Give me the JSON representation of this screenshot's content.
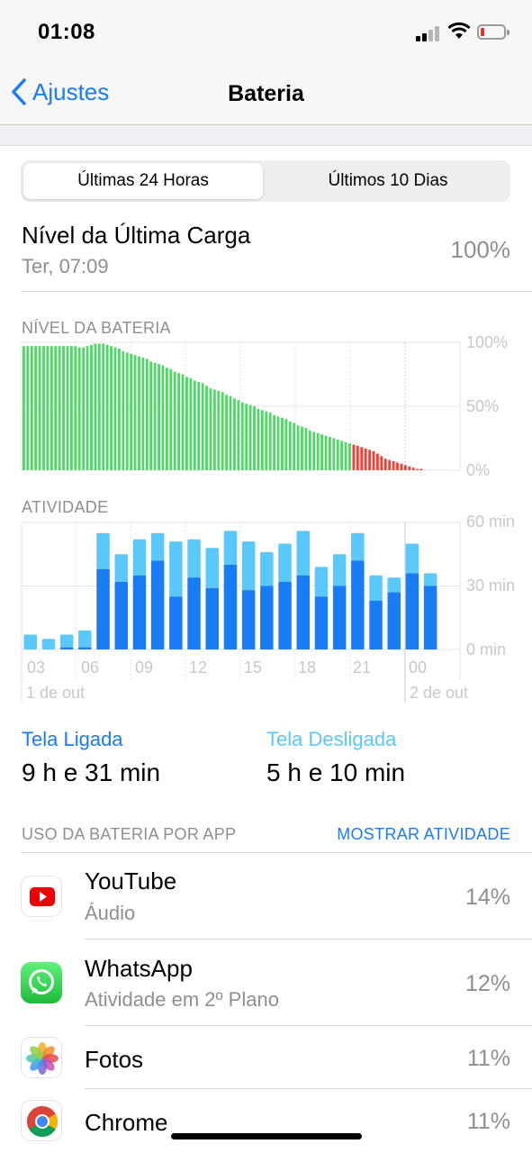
{
  "status": {
    "time": "01:08"
  },
  "nav": {
    "back_label": "Ajustes",
    "title": "Bateria"
  },
  "tabs": [
    "Últimas 24 Horas",
    "Últimos 10 Dias"
  ],
  "last_charge": {
    "title": "Nível da Última Carga",
    "subtitle": "Ter, 07:09",
    "value": "100%"
  },
  "battery_chart": {
    "label": "NÍVEL DA BATERIA",
    "y_ticks": [
      "100%",
      "50%",
      "0%"
    ]
  },
  "activity_chart": {
    "label": "ATIVIDADE",
    "y_ticks": [
      "60 min",
      "30 min",
      "0 min"
    ],
    "x_ticks": [
      "03",
      "06",
      "09",
      "12",
      "15",
      "18",
      "21",
      "00"
    ],
    "date_left": "1 de out",
    "date_right": "2 de out"
  },
  "chart_data": [
    {
      "type": "bar",
      "title": "NÍVEL DA BATERIA",
      "ylim": [
        0,
        100
      ],
      "y_ticks": [
        "100%",
        "50%",
        "0%"
      ],
      "low_threshold": 20,
      "colors": {
        "normal": "#4cd964",
        "low": "#ff3b30"
      },
      "values": [
        97,
        97,
        97,
        97,
        97,
        97,
        97,
        97,
        97,
        97,
        97,
        97,
        97,
        97,
        96,
        96,
        97,
        98,
        99,
        99,
        99,
        98,
        97,
        96,
        95,
        93,
        92,
        91,
        90,
        89,
        88,
        87,
        85,
        84,
        83,
        82,
        80,
        79,
        77,
        76,
        75,
        73,
        72,
        70,
        69,
        68,
        66,
        64,
        63,
        62,
        61,
        59,
        58,
        56,
        55,
        53,
        52,
        51,
        50,
        48,
        47,
        46,
        45,
        43,
        42,
        41,
        40,
        38,
        37,
        35,
        34,
        33,
        31,
        30,
        29,
        28,
        27,
        26,
        25,
        24,
        23,
        22,
        21,
        20,
        19,
        18,
        17,
        16,
        15,
        13,
        11,
        9,
        8,
        7,
        6,
        5,
        4,
        3,
        2,
        1,
        1
      ]
    },
    {
      "type": "bar",
      "title": "ATIVIDADE",
      "ylim": [
        0,
        60
      ],
      "y_ticks": [
        "60 min",
        "30 min",
        "0 min"
      ],
      "categories": [
        "03",
        "06",
        "09",
        "12",
        "15",
        "18",
        "21",
        "00"
      ],
      "series": [
        {
          "name": "Tela Ligada",
          "color": "#1a7cf5",
          "values": [
            0,
            0,
            1,
            1,
            38,
            32,
            35,
            42,
            25,
            34,
            29,
            40,
            28,
            30,
            32,
            35,
            25,
            30,
            42,
            23,
            27,
            36,
            30
          ]
        },
        {
          "name": "Tela Desligada",
          "color": "#5ac8fa",
          "values": [
            7,
            5,
            6,
            8,
            17,
            13,
            17,
            13,
            26,
            18,
            19,
            16,
            23,
            16,
            18,
            21,
            14,
            15,
            13,
            12,
            7,
            14,
            6
          ]
        }
      ]
    }
  ],
  "legend": {
    "on_label": "Tela Ligada",
    "on_value": "9 h e 31 min",
    "off_label": "Tela Desligada",
    "off_value": "5 h e 10 min",
    "on_color": "#1a7cf5",
    "off_color": "#5ac8fa"
  },
  "usage": {
    "header": "USO DA BATERIA POR APP",
    "action": "MOSTRAR ATIVIDADE",
    "apps": [
      {
        "name": "YouTube",
        "sub": "Áudio",
        "pct": "14%",
        "icon": "youtube-icon"
      },
      {
        "name": "WhatsApp",
        "sub": "Atividade em 2º Plano",
        "pct": "12%",
        "icon": "whatsapp-icon"
      },
      {
        "name": "Fotos",
        "sub": "",
        "pct": "11%",
        "icon": "photos-icon"
      },
      {
        "name": "Chrome",
        "sub": "",
        "pct": "11%",
        "icon": "chrome-icon"
      }
    ]
  }
}
